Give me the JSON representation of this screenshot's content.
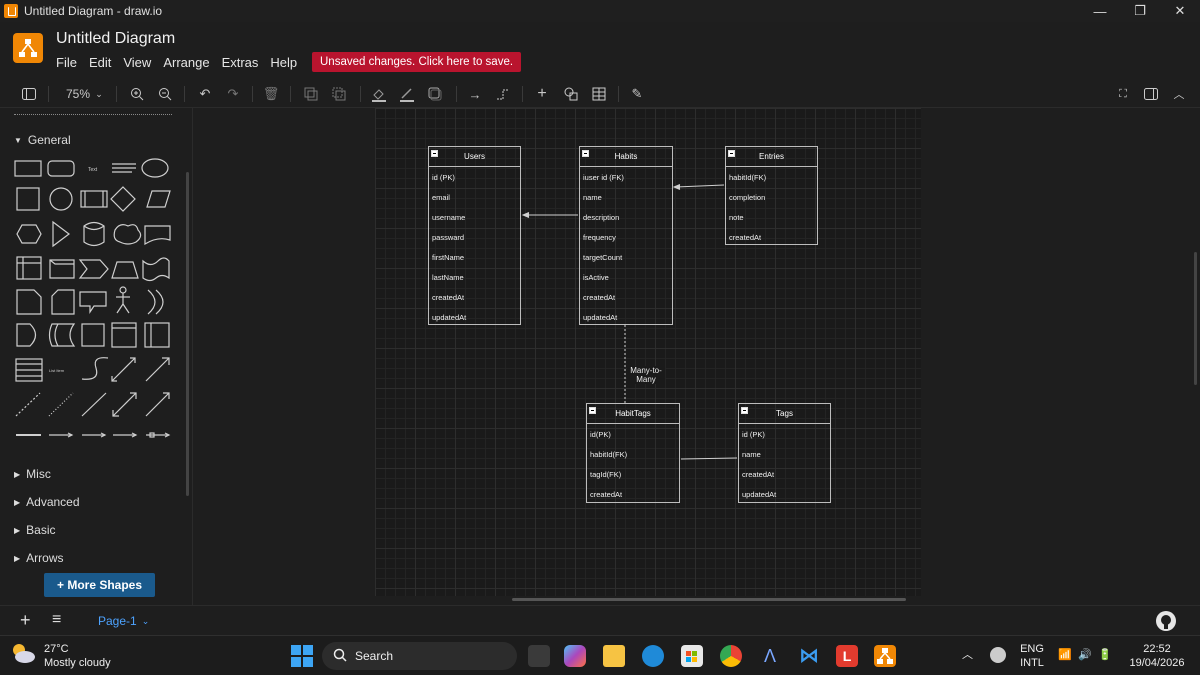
{
  "window": {
    "title": "Untitled Diagram - draw.io",
    "controls": [
      "—",
      "❐",
      "✕"
    ]
  },
  "header": {
    "doc_title": "Untitled Diagram",
    "menu": [
      "File",
      "Edit",
      "View",
      "Arrange",
      "Extras",
      "Help"
    ],
    "unsaved_label": "Unsaved changes. Click here to save."
  },
  "toolbar": {
    "zoom": "75%"
  },
  "sidebar": {
    "sections": {
      "general": "General",
      "misc": "Misc",
      "advanced": "Advanced",
      "basic": "Basic",
      "arrows": "Arrows"
    },
    "more_shapes": "+ More Shapes"
  },
  "diagram": {
    "tables": [
      {
        "title": "Users",
        "rows": [
          "id (PK)",
          "email",
          "username",
          "passward",
          "firstName",
          "lastName",
          "createdAt",
          "updatedAt"
        ]
      },
      {
        "title": "Habits",
        "rows": [
          "iuser id (FK)",
          "name",
          "description",
          "frequency",
          "targetCount",
          "isActive",
          "createdAt",
          "updatedAt"
        ]
      },
      {
        "title": "Entries",
        "rows": [
          "habitId(FK)",
          "completion",
          "note",
          "createdAt"
        ]
      },
      {
        "title": "HabitTags",
        "rows": [
          "id(PK)",
          "habitId(FK)",
          "tagId(FK)",
          "createdAt"
        ]
      },
      {
        "title": "Tags",
        "rows": [
          "id  (PK)",
          "name",
          "createdAt",
          "updatedAt"
        ]
      }
    ],
    "relation_label": "Many-to-\nMany"
  },
  "footer": {
    "add": "+",
    "menu": "≡",
    "page_tab": "Page-1"
  },
  "taskbar": {
    "temperature": "27°C",
    "weather": "Mostly cloudy",
    "search_placeholder": "Search",
    "lang": "ENG",
    "lang_sub": "INTL",
    "time": "22:52",
    "date": "19/04/2026"
  }
}
